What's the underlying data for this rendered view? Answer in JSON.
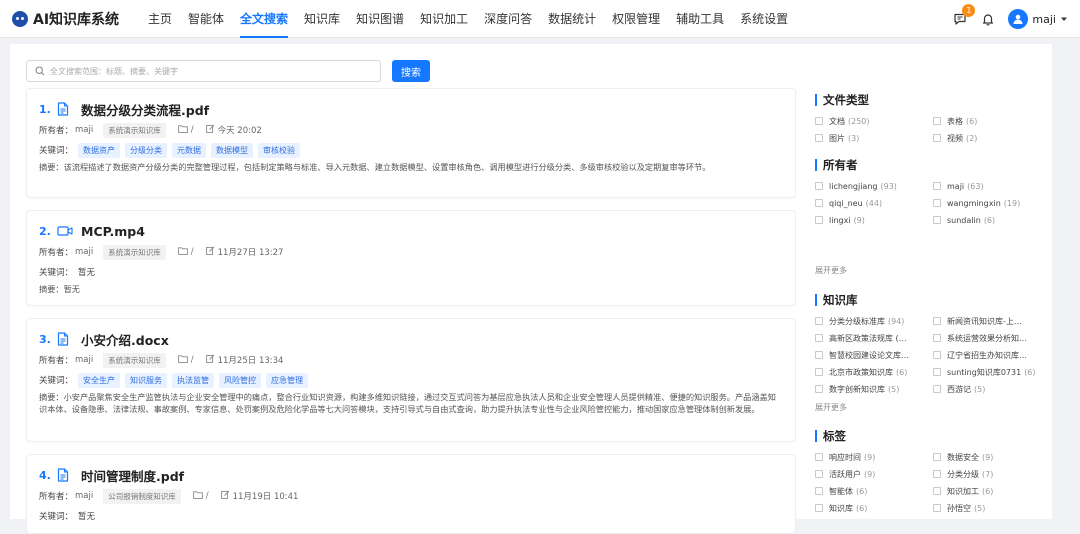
{
  "app": {
    "title": "AI知识库系统"
  },
  "nav": [
    {
      "label": "主页"
    },
    {
      "label": "智能体"
    },
    {
      "label": "全文搜索"
    },
    {
      "label": "知识库"
    },
    {
      "label": "知识图谱"
    },
    {
      "label": "知识加工"
    },
    {
      "label": "深度问答"
    },
    {
      "label": "数据统计"
    },
    {
      "label": "权限管理"
    },
    {
      "label": "辅助工具"
    },
    {
      "label": "系统设置"
    }
  ],
  "nav_active": "全文搜索",
  "header": {
    "notification_count": "1",
    "username": "maji"
  },
  "search": {
    "placeholder": "全文搜索范围：标题、摘要、关键字",
    "button_label": "搜索"
  },
  "labels": {
    "owner": "所有者：",
    "keywords": "关键词：",
    "folder": "/"
  },
  "results": [
    {
      "index": "1.",
      "icon": "document-icon",
      "name": "数据分级分类流程.pdf",
      "owner": "maji",
      "kb": "系统演示知识库",
      "date": "今天 20:02",
      "keywords": [
        "数据资产",
        "分级分类",
        "元数据",
        "数据模型",
        "审核校验"
      ],
      "summary": "摘要：该流程描述了数据资产分级分类的完整管理过程，包括制定策略与标准、导入元数据、建立数据模型、设置审核角色、调用模型进行分级分类、多级审核校验以及定期复审等环节。"
    },
    {
      "index": "2.",
      "icon": "video-icon",
      "name": "MCP.mp4",
      "owner": "maji",
      "kb": "系统演示知识库",
      "date": "11月27日 13:27",
      "keywords": [],
      "keywords_none": "暂无",
      "summary": "摘要：暂无"
    },
    {
      "index": "3.",
      "icon": "document-icon",
      "name": "小安介绍.docx",
      "owner": "maji",
      "kb": "系统演示知识库",
      "date": "11月25日 13:34",
      "keywords": [
        "安全生产",
        "知识服务",
        "执法监管",
        "风险管控",
        "应急管理"
      ],
      "summary": "摘要：小安产品聚焦安全生产监管执法与企业安全管理中的痛点，整合行业知识资源，构建多维知识链接，通过交互式问答为基层应急执法人员和企业安全管理人员提供精准、便捷的知识服务。产品涵盖知识本体、设备隐患、法律法规、事故案例、专家信息、处罚案例及危险化学品等七大问答模块，支持引导式与自由式查询，助力提升执法专业性与企业风险管控能力，推动国家应急管理体制创新发展。"
    },
    {
      "index": "4.",
      "icon": "document-icon",
      "name": "时间管理制度.pdf",
      "owner": "maji",
      "kb": "公司报销制度知识库",
      "date": "11月19日 10:41",
      "keywords": [],
      "keywords_none": "暂无",
      "summary": ""
    }
  ],
  "facets": {
    "file_type": {
      "title": "文件类型",
      "items": [
        {
          "label": "文档",
          "count": "(250)"
        },
        {
          "label": "表格",
          "count": "(6)"
        },
        {
          "label": "图片",
          "count": "(3)"
        },
        {
          "label": "视频",
          "count": "(2)"
        }
      ]
    },
    "owner": {
      "title": "所有者",
      "items": [
        {
          "label": "lichengjiang",
          "count": "(93)"
        },
        {
          "label": "maji",
          "count": "(63)"
        },
        {
          "label": "qiqi_neu",
          "count": "(44)"
        },
        {
          "label": "wangmingxin",
          "count": "(19)"
        },
        {
          "label": "lingxi",
          "count": "(9)"
        },
        {
          "label": "sundalin",
          "count": "(6)"
        }
      ],
      "more": "展开更多"
    },
    "kb": {
      "title": "知识库",
      "items": [
        {
          "label": "分类分级标准库",
          "count": "(94)"
        },
        {
          "label": "新闻资讯知识库-上…",
          "count": ""
        },
        {
          "label": "高新区政策法规库 (…",
          "count": ""
        },
        {
          "label": "系统运营效果分析知…",
          "count": ""
        },
        {
          "label": "智慧校园建设论文库…",
          "count": ""
        },
        {
          "label": "辽宁省招生办知识库…",
          "count": ""
        },
        {
          "label": "北京市政策知识库",
          "count": "(6)"
        },
        {
          "label": "sunting知识库0731",
          "count": "(6)"
        },
        {
          "label": "数字创新知识库",
          "count": "(5)"
        },
        {
          "label": "西游记",
          "count": "(5)"
        }
      ],
      "more": "展开更多"
    },
    "tags": {
      "title": "标签",
      "items": [
        {
          "label": "响应时间",
          "count": "(9)"
        },
        {
          "label": "数据安全",
          "count": "(9)"
        },
        {
          "label": "活跃用户",
          "count": "(9)"
        },
        {
          "label": "分类分级",
          "count": "(7)"
        },
        {
          "label": "智能体",
          "count": "(6)"
        },
        {
          "label": "知识加工",
          "count": "(6)"
        },
        {
          "label": "知识库",
          "count": "(6)"
        },
        {
          "label": "孙悟空",
          "count": "(5)"
        }
      ]
    }
  },
  "colors": {
    "accent": "#1677ff",
    "badge": "#fa8c16",
    "keyword_bg": "#e8f1ff"
  }
}
